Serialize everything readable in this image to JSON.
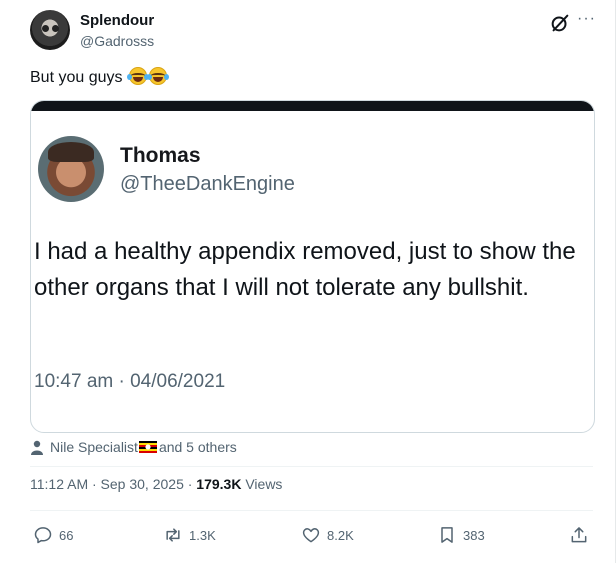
{
  "author": {
    "display_name": "Splendour",
    "handle": "@Gadrosss"
  },
  "header_icons": [
    "grok-icon",
    "more-icon"
  ],
  "tweet": {
    "text": "But you guys",
    "emojis": [
      "face-with-tears-of-joy",
      "face-with-tears-of-joy"
    ]
  },
  "embedded": {
    "name": "Thomas",
    "handle": "@TheeDankEngine",
    "body": "I had a healthy appendix removed, just to show the other organs that I will not tolerate any bullshit.",
    "timestamp": "10:47 am · 04/06/2021"
  },
  "liked_by": {
    "name": "Nile Specialist",
    "rest": "and 5 others"
  },
  "meta": {
    "time": "11:12 AM · Sep 30, 2025 · ",
    "views": "179.3K",
    "views_label": " Views"
  },
  "actions": {
    "replies": "66",
    "reposts": "1.3K",
    "likes": "8.2K",
    "bookmarks": "383"
  },
  "colors": {
    "text": "#0f1419",
    "secondary": "#536471",
    "border": "#cfd9de"
  }
}
